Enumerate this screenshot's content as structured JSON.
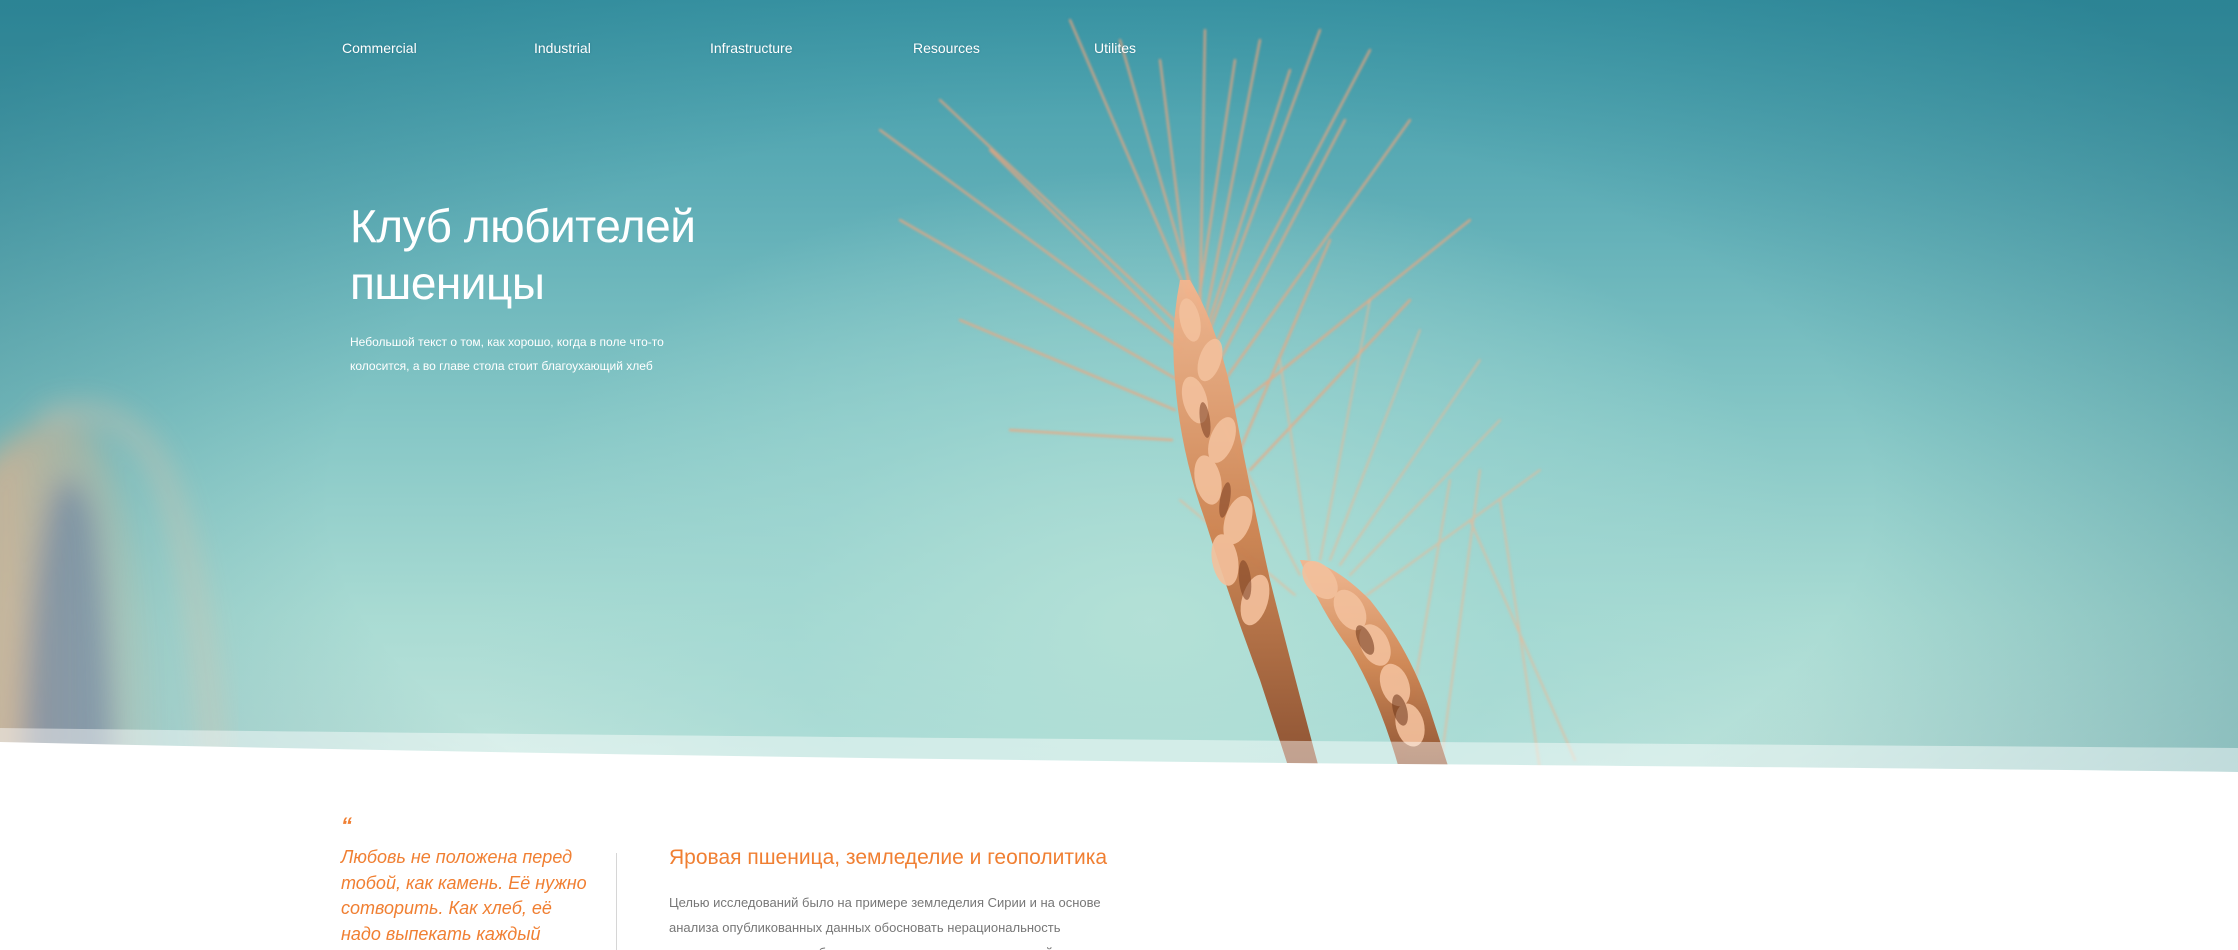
{
  "nav": {
    "items": [
      {
        "label": "Commercial"
      },
      {
        "label": "Industrial"
      },
      {
        "label": "Infrastructure"
      },
      {
        "label": "Resources"
      },
      {
        "label": "Utilites"
      }
    ]
  },
  "hero": {
    "title_line1": "Клуб любителей",
    "title_line2": "пшеницы",
    "subtitle": "Небольшой текст о том, как хорошо, когда в поле что-то колосится, а во главе стола стоит благоухающий хлеб"
  },
  "quote": {
    "mark": "“",
    "text": "Любовь не положена перед тобой, как камень. Её нужно сотворить. Как хлеб, её надо выпекать каждый"
  },
  "article": {
    "title": "Яровая пшеница, земледелие и геополитика",
    "body": "Целью исследований было на примере земледелия Сирии и на основе анализа опубликованных данных обосновать нерациональность монокультуры и целесообразность смешанных посевов яровой пшеницы на"
  },
  "colors": {
    "accent": "#f07f32",
    "sky_top": "#3e9aa9",
    "sky_bottom": "#bfe4dc",
    "body_text": "#777777",
    "divider": "#d6d6d6"
  },
  "icons": {
    "quote_mark": "open-quote-icon"
  }
}
